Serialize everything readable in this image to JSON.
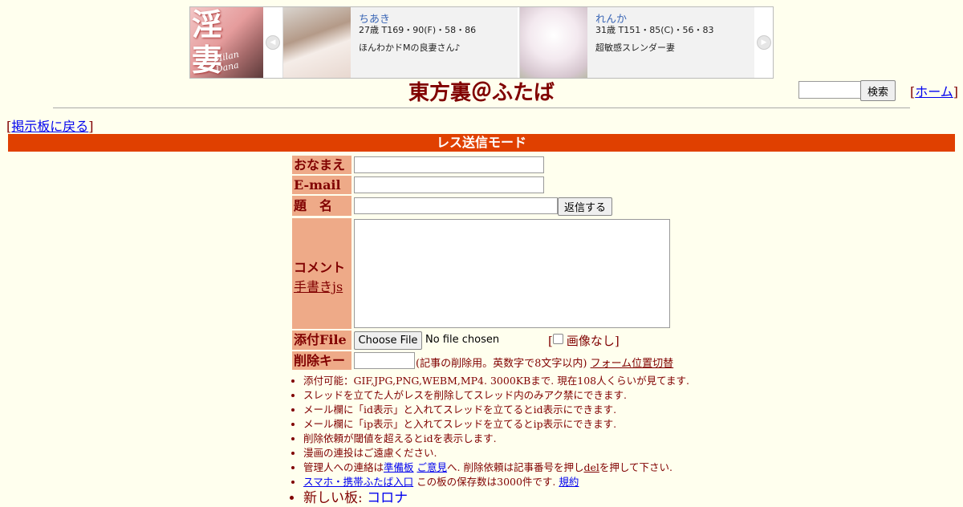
{
  "banner": {
    "logo_text": "淫妻",
    "logo_script": "Milan Dana",
    "cards": [
      {
        "name": "ちあき",
        "stats": "27歳 T169・90(F)・58・86",
        "desc": "ほんわかドMの良妻さん♪"
      },
      {
        "name": "れんか",
        "stats": "31歳 T151・85(C)・56・83",
        "desc": "超敏感スレンダー妻"
      }
    ],
    "prev_glyph": "◀",
    "next_glyph": "▶"
  },
  "site_title": "東方裏＠ふたば",
  "search": {
    "button": "検索",
    "value": ""
  },
  "home": {
    "open": "[",
    "label": "ホーム",
    "close": "]"
  },
  "back": {
    "open": "[",
    "label": "掲示板に戻る",
    "close": "]"
  },
  "mode_bar": "レス送信モード",
  "form": {
    "name_label": "おなまえ",
    "email_label": "E-mail",
    "subject_label": "題　名",
    "submit_button": "返信する",
    "comment_label": "コメント",
    "handwriting_link": "手書きjs",
    "file_label": "添付File",
    "choose_file_button": "Choose File",
    "no_file_text": "No file chosen",
    "no_image_open": "[",
    "no_image_label": "画像なし",
    "no_image_close": "]",
    "delete_key_label": "削除キー",
    "delete_key_note": "(記事の削除用。英数字で8文字以内)",
    "form_position_link": "フォーム位置切替"
  },
  "notes": {
    "n1": "添付可能：GIF,JPG,PNG,WEBM,MP4. 3000KBまで. 現在108人くらいが見てます.",
    "n2": "スレッドを立てた人がレスを削除してスレッド内のみアク禁にできます.",
    "n3": "メール欄に「id表示」と入れてスレッドを立てるとid表示にできます.",
    "n4": "メール欄に「ip表示」と入れてスレッドを立てるとip表示にできます.",
    "n5": "削除依頼が閾値を超えるとidを表示します.",
    "n6": "漫画の連投はご遠慮ください.",
    "n7_pre": "管理人への連絡は",
    "n7_link1": "準備板",
    "n7_link2": "ご意見",
    "n7_mid": "へ. 削除依頼は記事番号を押し",
    "n7_link3": "del",
    "n7_post": "を押して下さい.",
    "n8_link": "スマホ・携帯ふたば入口",
    "n8_text": " この板の保存数は3000件です.",
    "n8_link2": "規約",
    "n9_text": "新しい板: ",
    "n9_link": "コロナ"
  },
  "colors": {
    "background": "#ffffee",
    "text": "#800000",
    "mode_bar": "#e04000",
    "label_bg": "#eeaa88",
    "link": "#0000ee"
  }
}
